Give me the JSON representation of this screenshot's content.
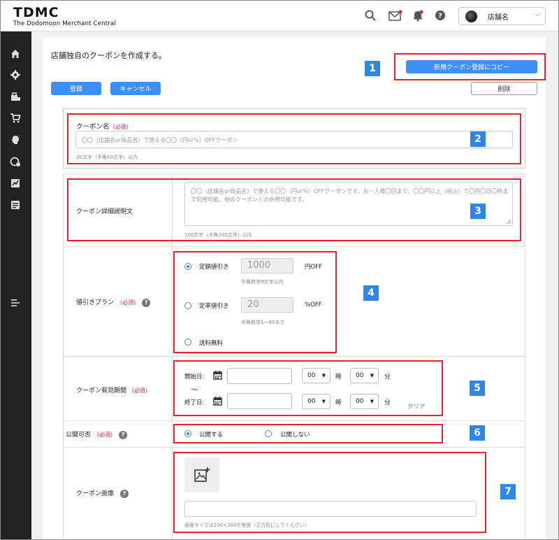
{
  "header": {
    "logo_mark": "TDMC",
    "logo_sub": "The Dodomoon Merchant Central",
    "store_name": "店舗名"
  },
  "sidebar": {
    "items": [
      "home-icon",
      "gear-icon",
      "store-icon",
      "cart-icon",
      "brain-icon",
      "coupon-settings-icon",
      "sales-chart-icon",
      "list-icon",
      "menu-icon"
    ]
  },
  "page": {
    "intro": "店舗独自のクーポンを作成する。",
    "copy_button": "新規クーポン登録にコピー",
    "register_button": "登録",
    "cancel_button": "キャンセル",
    "delete_button": "削除"
  },
  "form": {
    "coupon_name": {
      "label": "クーポン名",
      "required": "(必須)",
      "placeholder": "〇〇（店舗名or商品名）で使える〇〇（円or%）OFFクーポン",
      "hint": "30文字（半角60文字）以内"
    },
    "description": {
      "label": "クーポン詳細説明文",
      "placeholder": "〇〇（店舗名or商品名）で使える〇〇（円or%）OFFクーポンです。お一人様〇回まで、〇〇円以上（税込）で〇月〇日〇時まで利用可能。他のクーポンとの併用可能です。",
      "hint": "100文字（半角200文字）以内"
    },
    "discount": {
      "label": "値引きプラン",
      "required": "(必須)",
      "fixed_label": "定額値引き",
      "fixed_value": "1000",
      "fixed_unit": "円OFF",
      "fixed_hint": "半角数字9文字以内",
      "rate_label": "定率値引き",
      "rate_value": "20",
      "rate_unit": "%OFF",
      "rate_hint": "半角数字1〜99まで",
      "free_shipping": "送料無料",
      "selected": "fixed"
    },
    "period": {
      "label": "クーポン有効期間",
      "required": "(必須)",
      "start_label": "開始日:",
      "end_label": "終了日:",
      "tilde": "〜",
      "hour_value": "00",
      "minute_value": "00",
      "hour_unit": "時",
      "minute_unit": "分",
      "clear": "クリア"
    },
    "publish": {
      "label": "公開可否",
      "required": "(必須)",
      "yes": "公開する",
      "no": "公開しない",
      "selected": "yes"
    },
    "image": {
      "label": "クーポン画像",
      "hint": "画像サイズは200×200を推奨（正方形にしてください）"
    }
  },
  "annotations": [
    "1",
    "2",
    "3",
    "4",
    "5",
    "6",
    "7"
  ],
  "colors": {
    "accent": "#3d8ef5",
    "annotation_blue": "#2e86e6",
    "highlight_red": "#e8222b",
    "required_pink": "#e0245e",
    "sidebar_bg": "#222222"
  }
}
